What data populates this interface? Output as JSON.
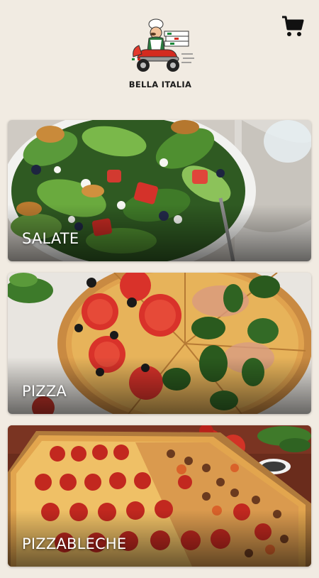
{
  "header": {
    "brand_name": "BELLA ITALIA",
    "logo_icon": "pizza-delivery-chef-on-scooter",
    "cart_icon": "shopping-cart-icon"
  },
  "categories": [
    {
      "label": "SALATE",
      "image": "salad-photo"
    },
    {
      "label": "PIZZA",
      "image": "pizza-photo"
    },
    {
      "label": "PIZZABLECHE",
      "image": "sheet-pizza-photo"
    }
  ],
  "colors": {
    "background": "#f1ebe2",
    "label_text": "#ffffff",
    "cart_icon": "#111111"
  }
}
